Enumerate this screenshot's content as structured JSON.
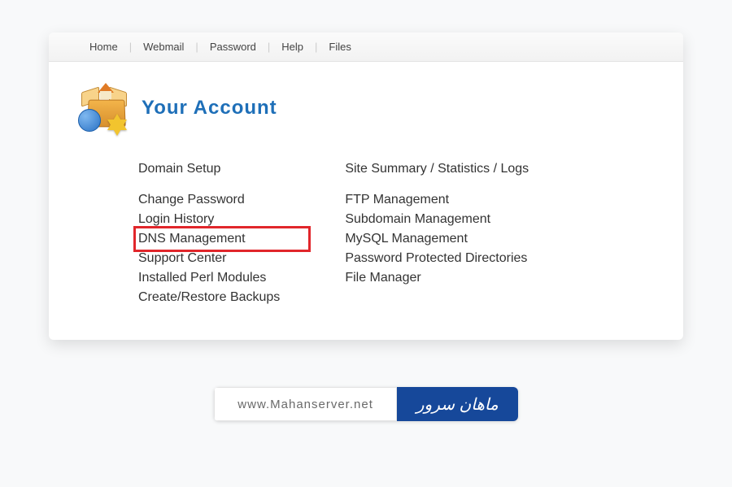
{
  "nav": {
    "items": [
      "Home",
      "Webmail",
      "Password",
      "Help",
      "Files"
    ]
  },
  "page": {
    "title": "Your Account"
  },
  "columns": {
    "left": {
      "head": "Domain Setup",
      "items": [
        "Change Password",
        "Login History",
        "DNS Management",
        "Support Center",
        "Installed Perl Modules",
        "Create/Restore Backups"
      ]
    },
    "right": {
      "head": "Site Summary / Statistics / Logs",
      "items": [
        "FTP Management",
        "Subdomain Management",
        "MySQL Management",
        "Password Protected Directories",
        "File Manager"
      ]
    }
  },
  "highlight": {
    "target_label": "DNS Management"
  },
  "watermark": {
    "url": "www.Mahanserver.net",
    "brand": "ماهان سرور"
  }
}
